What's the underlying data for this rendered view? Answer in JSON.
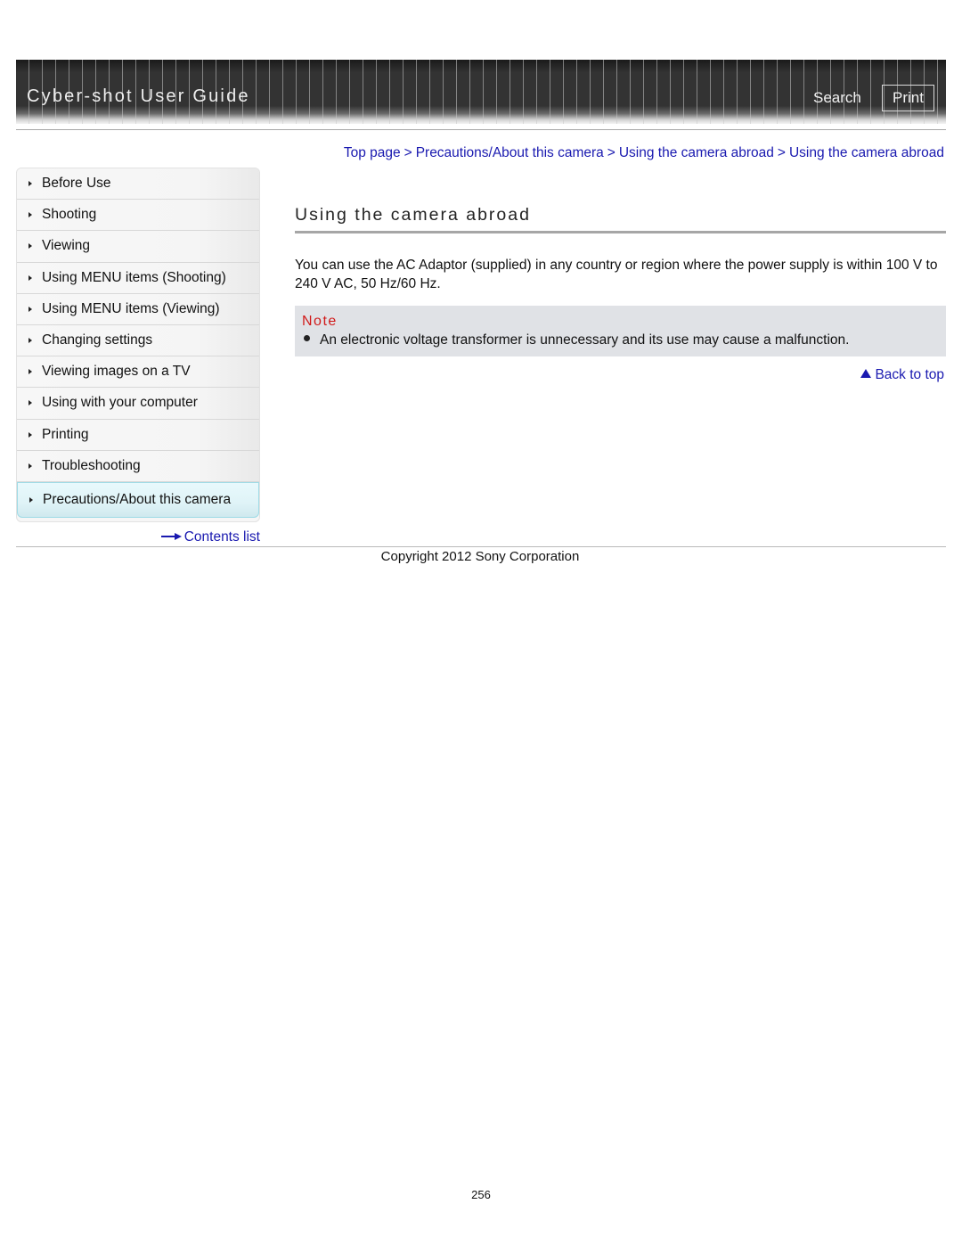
{
  "header": {
    "title": "Cyber-shot User Guide",
    "search_label": "Search",
    "print_label": "Print"
  },
  "breadcrumb": [
    {
      "label": "Top page"
    },
    {
      "label": "Precautions/About this camera"
    },
    {
      "label": "Using the camera abroad"
    },
    {
      "label": "Using the camera abroad"
    }
  ],
  "breadcrumb_separator": ">",
  "sidebar": {
    "items": [
      {
        "label": "Before Use"
      },
      {
        "label": "Shooting"
      },
      {
        "label": "Viewing"
      },
      {
        "label": "Using MENU items (Shooting)"
      },
      {
        "label": "Using MENU items (Viewing)"
      },
      {
        "label": "Changing settings"
      },
      {
        "label": "Viewing images on a TV"
      },
      {
        "label": "Using with your computer"
      },
      {
        "label": "Printing"
      },
      {
        "label": "Troubleshooting"
      },
      {
        "label": "Precautions/About this camera",
        "active": true
      }
    ],
    "contents_link": "Contents list"
  },
  "main": {
    "title": "Using the camera abroad",
    "body": "You can use the AC Adaptor (supplied) in any country or region where the power supply is within 100 V to 240 V AC, 50 Hz/60 Hz.",
    "note": {
      "title": "Note",
      "items": [
        "An electronic voltage transformer is unnecessary and its use may cause a malfunction."
      ]
    },
    "back_to_top": "Back to top"
  },
  "footer": {
    "copyright": "Copyright 2012 Sony Corporation",
    "page_number": "256"
  },
  "colors": {
    "link": "#1a1ab0",
    "note_title": "#d11a1a",
    "note_background": "#e0e2e6",
    "active_nav": "#dff3f7"
  }
}
